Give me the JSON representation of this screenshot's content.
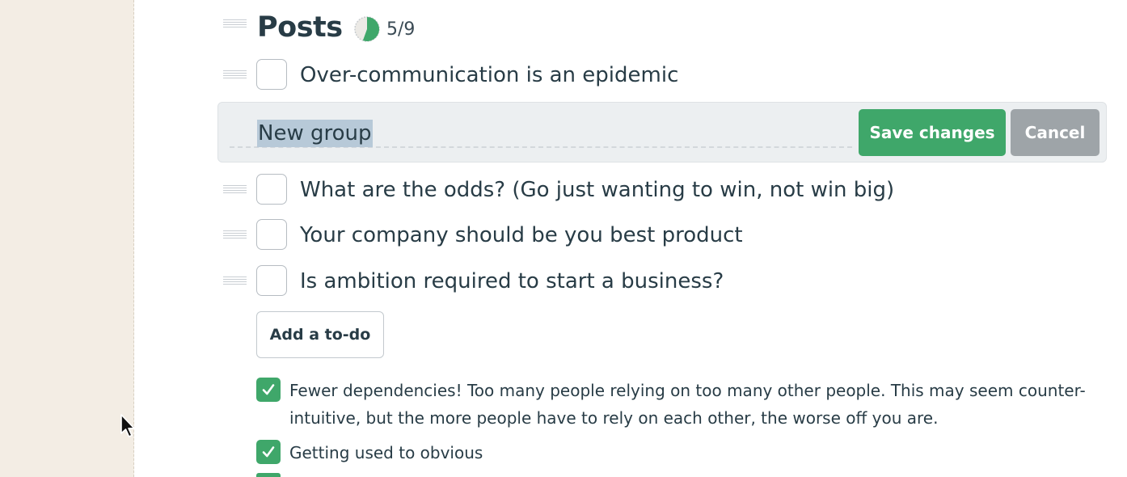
{
  "list": {
    "title": "Posts",
    "progress_text": "5/9",
    "completed_fraction": 0.5556,
    "progress_color": "#3fa76a"
  },
  "todos": [
    {
      "label": "Over-communication is an epidemic",
      "done": false
    },
    {
      "label": "What are the odds? (Go just wanting to win, not win big)",
      "done": false
    },
    {
      "label": "Your company should be you best product",
      "done": false
    },
    {
      "label": "Is ambition required to start a business?",
      "done": false
    }
  ],
  "group_editor": {
    "input_value": "New group",
    "save_label": "Save changes",
    "cancel_label": "Cancel"
  },
  "add_todo_label": "Add a to-do",
  "completed": [
    {
      "line1": "Fewer dependencies! Too many people relying on too many other people. This may seem counter-",
      "line2": "intuitive, but the more people have to rely on each other, the worse off you are."
    },
    {
      "line1": "Getting used to obvious"
    }
  ],
  "colors": {
    "accent": "#3fa76a",
    "cancel": "#9ea4a8",
    "sidebar": "#f3ede4",
    "text": "#283c46",
    "selection": "#b7c9d8"
  }
}
